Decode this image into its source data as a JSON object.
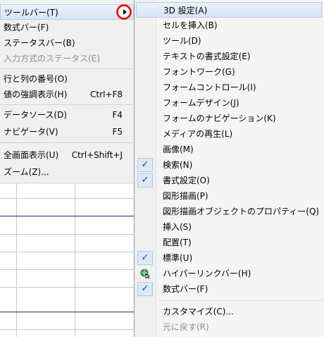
{
  "view_menu": {
    "items": [
      {
        "label": "ツールバー(T)",
        "highlighted": true
      },
      {
        "label": "数式バー(F)"
      },
      {
        "label": "ステータスバー(B)"
      },
      {
        "label": "入力方式のステータス(E)",
        "disabled": true
      },
      {
        "label": "行と列の番号(O)"
      },
      {
        "label": "値の強調表示(H)",
        "shortcut": "Ctrl+F8"
      },
      {
        "label": "データソース(D)",
        "shortcut": "F4"
      },
      {
        "label": "ナビゲータ(V)",
        "shortcut": "F5"
      },
      {
        "label": "全画面表示(U)",
        "shortcut": "Ctrl+Shift+J"
      },
      {
        "label": "ズーム(Z)..."
      }
    ],
    "submenu_arrow_icon": "triangle-right-icon",
    "highlight_circle_color": "#e0201b"
  },
  "toolbar_submenu": {
    "items": [
      {
        "label": "3D 設定(A)",
        "highlighted": true
      },
      {
        "label": "セルを挿入(B)"
      },
      {
        "label": "ツール(D)"
      },
      {
        "label": "テキストの書式設定(E)"
      },
      {
        "label": "フォントワーク(G)"
      },
      {
        "label": "フォームコントロール(I)"
      },
      {
        "label": "フォームデザイン(J)"
      },
      {
        "label": "フォームのナビゲーション(K)"
      },
      {
        "label": "メディアの再生(L)"
      },
      {
        "label": "画像(M)"
      },
      {
        "label": "検索(N)",
        "checked": true
      },
      {
        "label": "書式設定(O)",
        "checked": true
      },
      {
        "label": "図形描画(P)"
      },
      {
        "label": "図形描画オブジェクトのプロパティー(Q)"
      },
      {
        "label": "挿入(S)"
      },
      {
        "label": "配置(T)"
      },
      {
        "label": "標準(U)",
        "checked": true
      },
      {
        "label": "ハイパーリンクバー(H)",
        "icon": "hyperlink-globe-icon"
      },
      {
        "label": "数式バー(F)",
        "checked": true
      },
      {
        "label": "カスタマイズ(C)..."
      },
      {
        "label": "元に戻す(R)",
        "disabled": true
      }
    ],
    "check_mark": "✓"
  }
}
